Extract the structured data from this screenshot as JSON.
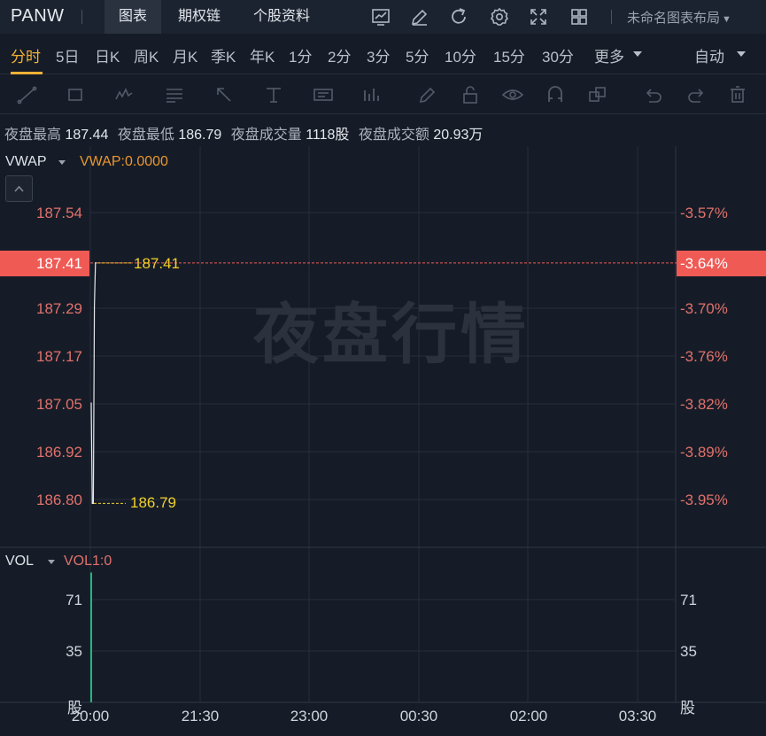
{
  "header": {
    "ticker": "PANW",
    "tabs": [
      "图表",
      "期权链",
      "个股资料"
    ],
    "layout_name": "未命名图表布局"
  },
  "top_icons": [
    "chart-icon",
    "edit-icon",
    "refresh-icon",
    "settings-icon",
    "fullscreen-icon",
    "grid-layout-icon"
  ],
  "periods": [
    "分时",
    "5日",
    "日K",
    "周K",
    "月K",
    "季K",
    "年K",
    "1分",
    "2分",
    "3分",
    "5分",
    "10分",
    "15分",
    "30分",
    "更多"
  ],
  "active_period": "分时",
  "auto_label": "自动",
  "draw_tools": [
    "line-tool-icon",
    "rect-tool-icon",
    "wave-tool-icon",
    "fib-tool-icon",
    "arrow-tool-icon",
    "text-tool-icon",
    "note-tool-icon",
    "bar-pattern-icon",
    "pen-icon",
    "lock-icon",
    "eye-icon",
    "magnet-icon",
    "layers-icon",
    "undo-icon",
    "redo-icon",
    "trash-icon"
  ],
  "stats": {
    "high_label": "夜盘最高",
    "high_value": "187.44",
    "low_label": "夜盘最低",
    "low_value": "186.79",
    "volume_label": "夜盘成交量",
    "volume_value": "1118股",
    "turnover_label": "夜盘成交额",
    "turnover_value": "20.93万"
  },
  "indicators": {
    "main_name": "VWAP",
    "main_value": "VWAP:0.0000",
    "sub_name": "VOL",
    "sub_value": "VOL1:0"
  },
  "watermark": "夜盘行情",
  "chart_data": {
    "type": "line",
    "title": "",
    "xlabel": "",
    "ylabel": "",
    "y_ticks": [
      "187.54",
      "187.29",
      "187.17",
      "187.05",
      "186.92",
      "186.80"
    ],
    "pct_ticks": [
      "-3.57%",
      "-3.70%",
      "-3.76%",
      "-3.82%",
      "-3.89%",
      "-3.95%"
    ],
    "ylim": [
      186.8,
      187.54
    ],
    "last_price": "187.41",
    "last_pct": "-3.64%",
    "high_marker": "187.41",
    "low_marker": "186.79",
    "x_ticks": [
      "20:00",
      "21:30",
      "23:00",
      "00:30",
      "02:00",
      "03:30"
    ],
    "series": [
      {
        "values": [
          {
            "t": "20:00",
            "v": 187.05
          },
          {
            "t": "20:00",
            "v": 186.79
          },
          {
            "t": "20:00",
            "v": 186.79
          },
          {
            "t": "20:00",
            "v": 187.3
          },
          {
            "t": "20:00",
            "v": 187.41
          },
          {
            "t": "20:00",
            "v": 187.41
          }
        ]
      }
    ],
    "volume_ticks": [
      "71",
      "35"
    ],
    "volume_unit": "股",
    "volume_ylim": [
      0,
      90
    ],
    "volume_bars": [
      {
        "t": "20:00",
        "v": 79
      }
    ],
    "grid": true
  },
  "colors": {
    "background": "#161c27",
    "accent": "#f2b236",
    "down": "#ef5a55",
    "marker": "#f0d02a",
    "volume_bar": "#26b47f"
  }
}
